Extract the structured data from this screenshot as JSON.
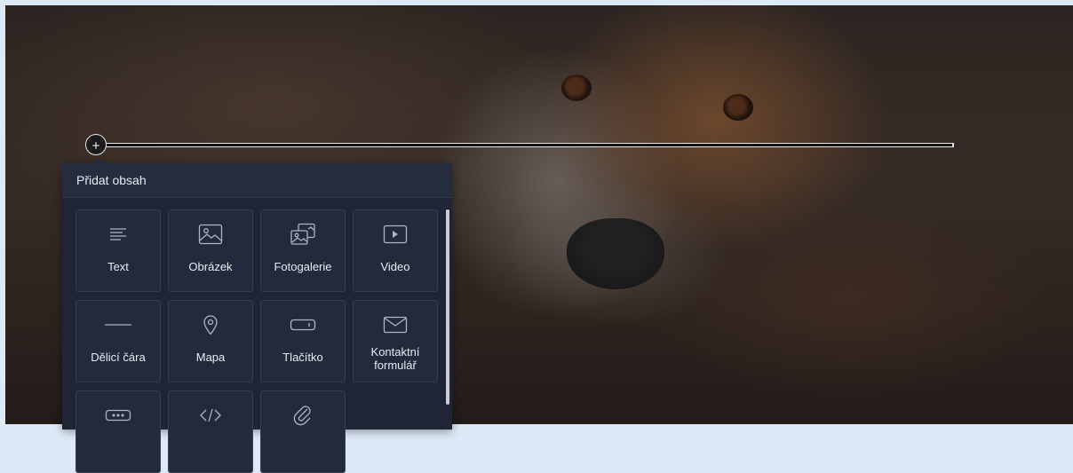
{
  "panel": {
    "title": "Přidat obsah",
    "tiles": [
      {
        "label": "Text",
        "icon": "text-lines-icon"
      },
      {
        "label": "Obrázek",
        "icon": "image-icon"
      },
      {
        "label": "Fotogalerie",
        "icon": "gallery-icon"
      },
      {
        "label": "Video",
        "icon": "video-play-icon"
      },
      {
        "label": "Dělicí čára",
        "icon": "divider-line-icon"
      },
      {
        "label": "Mapa",
        "icon": "map-pin-icon"
      },
      {
        "label": "Tlačítko",
        "icon": "button-icon"
      },
      {
        "label": "Kontaktní formulář",
        "icon": "envelope-icon"
      },
      {
        "label": "",
        "icon": "form-field-icon"
      },
      {
        "label": "",
        "icon": "code-icon"
      },
      {
        "label": "",
        "icon": "paperclip-icon"
      }
    ]
  },
  "add_button": {
    "label": "+"
  },
  "colors": {
    "panel_bg": "#1f2535",
    "tile_bg": "#232a3c",
    "tile_border": "#353d52",
    "text": "#e8ebf2"
  }
}
